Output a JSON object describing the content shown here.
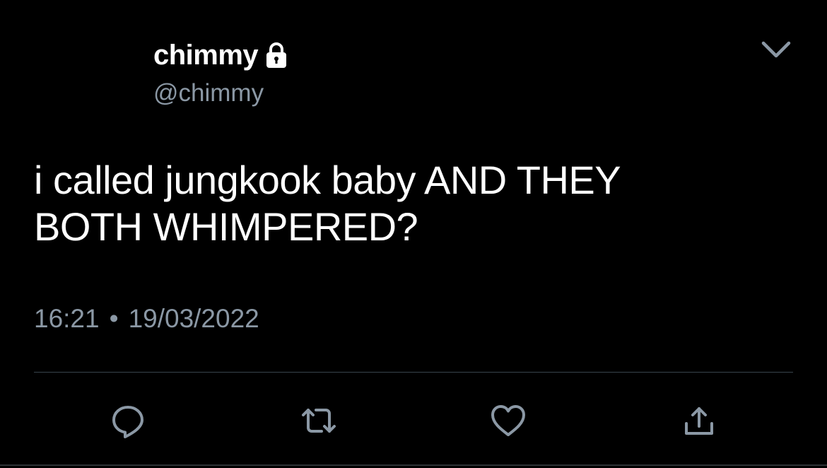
{
  "tweet": {
    "display_name": "chimmy",
    "handle": "@chimmy",
    "text": "i called jungkook baby AND THEY\nBOTH WHIMPERED?",
    "time": "16:21",
    "separator": "•",
    "date": "19/03/2022"
  },
  "icons": {
    "lock": "lock-icon",
    "more": "chevron-down-icon",
    "reply": "reply-icon",
    "retweet": "retweet-icon",
    "like": "heart-icon",
    "share": "share-icon"
  },
  "colors": {
    "background": "#000000",
    "text_primary": "#ffffff",
    "text_secondary": "#8b98a5",
    "divider": "#38444d"
  }
}
